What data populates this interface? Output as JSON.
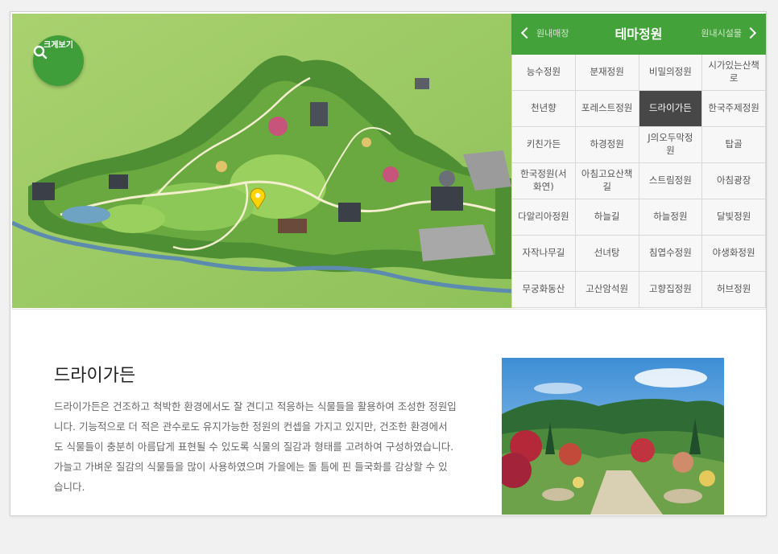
{
  "map": {
    "zoom_label": "크게보기"
  },
  "nav": {
    "prev_label": "원내매장",
    "title": "테마정원",
    "next_label": "원내시설물"
  },
  "gardens": [
    "능수정원",
    "분재정원",
    "비밀의정원",
    "시가있는산책로",
    "천년향",
    "포레스트정원",
    "드라이가든",
    "한국주제정원",
    "키친가든",
    "하경정원",
    "J의오두막정원",
    "탑골",
    "한국정원(서화연)",
    "아침고요산책길",
    "스트림정원",
    "아침광장",
    "다알리아정원",
    "하늘길",
    "하늘정원",
    "달빛정원",
    "자작나무길",
    "선녀탕",
    "침엽수정원",
    "야생화정원",
    "무궁화동산",
    "고산암석원",
    "고향집정원",
    "허브정원"
  ],
  "active_garden": "드라이가든",
  "detail": {
    "title": "드라이가든",
    "description": "드라이가든은 건조하고 척박한 환경에서도 잘 견디고 적응하는 식물들을 활용하여 조성한 정원입니다. 기능적으로 더 적은 관수로도 유지가능한 정원의 컨셉을 가지고 있지만, 건조한 환경에서도 식물들이 충분히 아름답게 표현될 수 있도록 식물의 질감과 형태를 고려하여 구성하였습니다. 가늘고 가벼운 질감의 식물들을 많이 사용하였으며 가을에는 돌 틈에 핀 들국화를 감상할 수 있습니다."
  },
  "colors": {
    "accent_green": "#43a33a",
    "active_cell": "#474747"
  }
}
